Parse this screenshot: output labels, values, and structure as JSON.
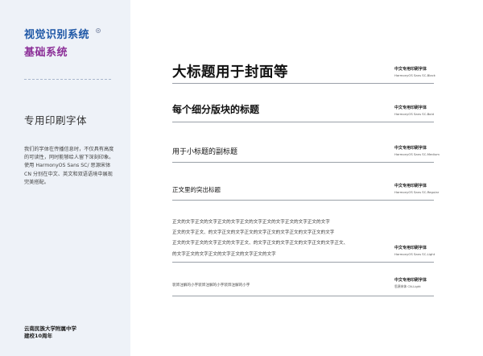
{
  "sidebar": {
    "title_main": "视觉识别系统",
    "title_sub": "基础系统",
    "title_icon": "circle-dot-icon",
    "section_heading": "专用印刷字体",
    "description": [
      "我们的字体在传播信息时，不仅具有高度的可读性，同时能够给人留下深刻印象。",
      "使用 HarmonyOS Sans SC/ 思源宋体 CN 分别在中文、英文和双语语境中展现完美搭配。"
    ],
    "school_line1": "云南民族大学附属中学",
    "school_line2": "建校10周年"
  },
  "rows": [
    {
      "sample": "大标题用于封面等",
      "label": "中文专用印刷字体",
      "font_name": "HarmonyOS Sans SC-Black"
    },
    {
      "sample": "每个细分版块的标题",
      "label": "中文专用印刷字体",
      "font_name": "HarmonyOS Sans SC-Bold"
    },
    {
      "sample": "用于小标题的副标题",
      "label": "中文专用印刷字体",
      "font_name": "HarmonyOS Sans SC-Medium"
    },
    {
      "sample": "正文里的突出标题",
      "label": "中文专用印刷字体",
      "font_name": "HarmonyOS Sans SC-Regular"
    },
    {
      "sample_lines": [
        "正文的文字正文的文字正文的文字正文的文字正文的文字正文的文字正文的文字",
        "正文的文字正文、的文字正文的文字正文的文字正文的文字正文的文字正文的文字",
        "正文的文字正文的文字正文的文字正文、的文字正文的文字正文的文字正文的文字正文、",
        "的文字正文的文字正文的文字正文的文字正文的文字"
      ],
      "label": "中文专用印刷字体",
      "font_name": "HarmonyOS Sans SC-Light"
    },
    {
      "sample": "装饰注解的小字装饰注解的小字装饰注解的小字",
      "label": "中文专用印刷字体",
      "font_name": "思源宋体 CN-Light"
    }
  ]
}
